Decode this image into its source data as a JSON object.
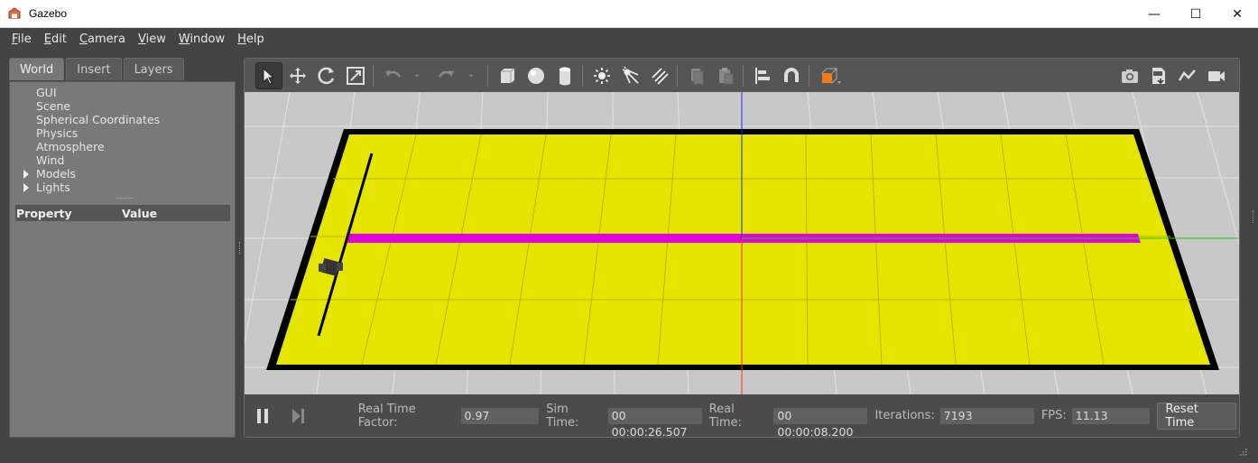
{
  "window": {
    "title": "Gazebo",
    "min_glyph": "—",
    "max_glyph": "☐",
    "close_glyph": "✕"
  },
  "menu": [
    {
      "u": "F",
      "rest": "ile"
    },
    {
      "u": "E",
      "rest": "dit"
    },
    {
      "u": "C",
      "rest": "amera"
    },
    {
      "u": "V",
      "rest": "iew"
    },
    {
      "u": "W",
      "rest": "indow"
    },
    {
      "u": "H",
      "rest": "elp"
    }
  ],
  "left_tabs": [
    "World",
    "Insert",
    "Layers"
  ],
  "tree": {
    "gui": "GUI",
    "scene": "Scene",
    "spherical": "Spherical Coordinates",
    "physics": "Physics",
    "atmosphere": "Atmosphere",
    "wind": "Wind",
    "models": "Models",
    "lights": "Lights"
  },
  "properties": {
    "col_property": "Property",
    "col_value": "Value"
  },
  "toolbar_icons": [
    "select-arrow-icon",
    "translate-icon",
    "rotate-icon",
    "scale-icon",
    "undo-icon",
    "redo-icon",
    "box-icon",
    "sphere-icon",
    "cylinder-icon",
    "point-light-icon",
    "spot-light-icon",
    "directional-light-icon",
    "copy-icon",
    "paste-icon",
    "align-icon",
    "magnet-icon",
    "view-angle-icon",
    "screenshot-icon",
    "log-icon",
    "plot-icon",
    "video-icon"
  ],
  "colors": {
    "ground": "#e5e500",
    "border": "#000000",
    "line": "#e000e0",
    "viewport_bg": "#c8c8c8"
  },
  "status": {
    "rtf_label": "Real Time Factor:",
    "rtf_value": "0.97",
    "sim_label": "Sim Time:",
    "sim_value": "00 00:00:26.507",
    "real_label": "Real Time:",
    "real_value": "00 00:00:08.200",
    "iter_label": "Iterations:",
    "iter_value": "7193",
    "fps_label": "FPS:",
    "fps_value": "11.13",
    "reset_label": "Reset Time"
  }
}
